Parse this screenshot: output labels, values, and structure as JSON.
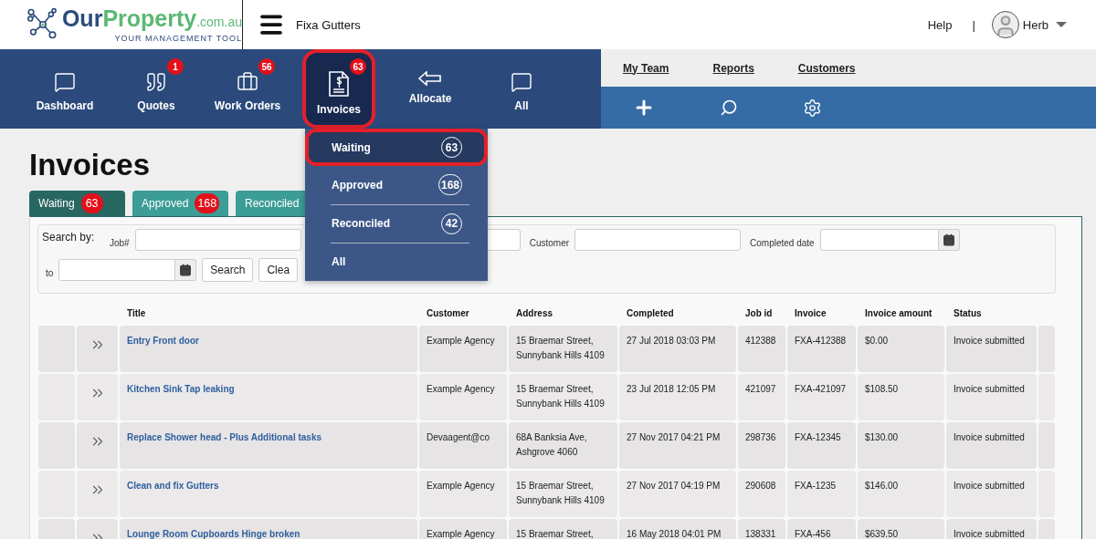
{
  "header": {
    "logo": {
      "our": "Our",
      "property": "Property",
      "domain": ".com.au",
      "tagline": "YOUR MANAGEMENT TOOL"
    },
    "company": "Fixa Gutters",
    "help": "Help",
    "separator": "|",
    "user": "Herb"
  },
  "nav": {
    "items": [
      {
        "label": "Dashboard",
        "selected": false
      },
      {
        "label": "Quotes",
        "badge": "1",
        "selected": false
      },
      {
        "label": "Work Orders",
        "badge": "56",
        "selected": false
      },
      {
        "label": "Invoices",
        "badge": "63",
        "selected": true
      },
      {
        "label": "Allocate",
        "selected": false
      },
      {
        "label": "All",
        "selected": false
      }
    ],
    "links": [
      "My Team",
      "Reports",
      "Customers"
    ]
  },
  "dropdown": {
    "items": [
      {
        "label": "Waiting",
        "count": "63",
        "selected": true
      },
      {
        "label": "Approved",
        "count": "168",
        "selected": false
      },
      {
        "label": "Reconciled",
        "count": "42",
        "selected": false
      },
      {
        "label": "All",
        "selected": false
      }
    ]
  },
  "page_title": "Invoices",
  "tabs": [
    {
      "label": "Waiting",
      "badge": "63",
      "selected": true
    },
    {
      "label": "Approved",
      "badge": "168",
      "selected": false
    },
    {
      "label": "Reconciled",
      "selected": false
    }
  ],
  "search": {
    "heading": "Search by:",
    "fields": [
      {
        "label": "Job#",
        "kind": "text"
      },
      {
        "kind": "text"
      },
      {
        "label": "Customer",
        "kind": "text"
      },
      {
        "label": "Completed date",
        "kind": "date"
      },
      {
        "label": "to",
        "kind": "date"
      }
    ],
    "buttons": [
      "Search",
      "Clea"
    ]
  },
  "table": {
    "columns": [
      "Title",
      "Customer",
      "Address",
      "Completed",
      "Job id",
      "Invoice",
      "Invoice amount",
      "Status"
    ],
    "rows": [
      {
        "title": "Entry Front door",
        "customer": "Example Agency",
        "address": "15 Braemar Street, Sunnybank Hills 4109",
        "completed": "27 Jul 2018 03:03 PM",
        "job_id": "412388",
        "invoice": "FXA-412388",
        "amount": "$0.00",
        "status": "Invoice submitted"
      },
      {
        "title": "Kitchen Sink Tap leaking",
        "customer": "Example Agency",
        "address": "15 Braemar Street, Sunnybank Hills 4109",
        "completed": "23 Jul 2018 12:05 PM",
        "job_id": "421097",
        "invoice": "FXA-421097",
        "amount": "$108.50",
        "status": "Invoice submitted"
      },
      {
        "title": "Replace Shower head - Plus Additional tasks",
        "customer": "Devaagent@co",
        "address": "68A Banksia Ave, Ashgrove 4060",
        "completed": "27 Nov 2017 04:21 PM",
        "job_id": "298736",
        "invoice": "FXA-12345",
        "amount": "$130.00",
        "status": "Invoice submitted"
      },
      {
        "title": "Clean and fix Gutters",
        "customer": "Example Agency",
        "address": "15 Braemar Street, Sunnybank Hills 4109",
        "completed": "27 Nov 2017 04:19 PM",
        "job_id": "290608",
        "invoice": "FXA-1235",
        "amount": "$146.00",
        "status": "Invoice submitted"
      },
      {
        "title": "Lounge Room Cupboards Hinge broken",
        "customer": "Example Agency",
        "address": "15 Braemar Street,",
        "completed": "16 May 2018 04:01 PM",
        "job_id": "138331",
        "invoice": "FXA-456",
        "amount": "$639.50",
        "status": "Invoice submitted"
      }
    ]
  }
}
